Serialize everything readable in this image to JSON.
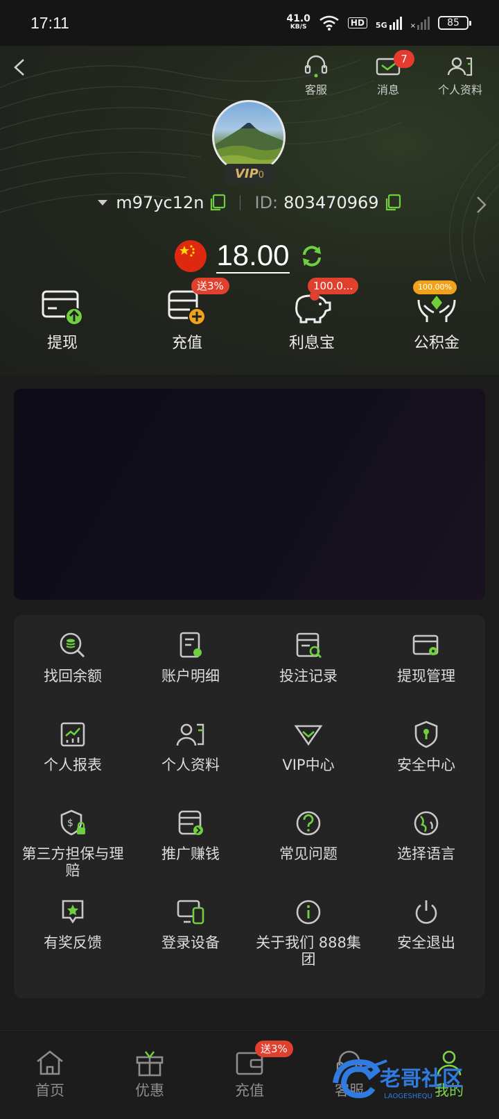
{
  "status_bar": {
    "time": "17:11",
    "net_speed": "41.0",
    "net_unit": "KB/S",
    "hd": "HD",
    "signal": "5G",
    "battery": "85"
  },
  "header": {
    "top_icons": [
      {
        "label": "客服",
        "icon": "headset-icon"
      },
      {
        "label": "消息",
        "icon": "mail-icon",
        "badge": "7"
      },
      {
        "label": "个人资料",
        "icon": "profile-card-icon"
      }
    ],
    "vip_text": "VIP",
    "vip_level": "0",
    "username": "m97yc12n",
    "id_label": "ID:",
    "id_value": "803470969",
    "balance": "18.00"
  },
  "actions": [
    {
      "label": "提现",
      "icon": "withdraw-card-icon",
      "badge": ""
    },
    {
      "label": "充值",
      "icon": "deposit-icon",
      "badge": "送3%"
    },
    {
      "label": "利息宝",
      "icon": "piggy-bank-icon",
      "badge": "100.0..."
    },
    {
      "label": "公积金",
      "icon": "fund-hands-icon",
      "badge": "100.00%"
    }
  ],
  "menu": [
    {
      "label": "找回余额",
      "icon": "recover-balance-icon"
    },
    {
      "label": "账户明细",
      "icon": "account-detail-icon"
    },
    {
      "label": "投注记录",
      "icon": "bet-record-icon"
    },
    {
      "label": "提现管理",
      "icon": "withdraw-manage-icon"
    },
    {
      "label": "个人报表",
      "icon": "report-chart-icon"
    },
    {
      "label": "个人资料",
      "icon": "profile-icon"
    },
    {
      "label": "VIP中心",
      "icon": "vip-diamond-icon"
    },
    {
      "label": "安全中心",
      "icon": "shield-icon"
    },
    {
      "label": "第三方担保与理赔",
      "icon": "guarantee-shield-icon"
    },
    {
      "label": "推广赚钱",
      "icon": "promote-icon"
    },
    {
      "label": "常见问题",
      "icon": "question-icon"
    },
    {
      "label": "选择语言",
      "icon": "globe-icon"
    },
    {
      "label": "有奖反馈",
      "icon": "feedback-star-icon"
    },
    {
      "label": "登录设备",
      "icon": "devices-icon"
    },
    {
      "label": "关于我们 888集团",
      "icon": "info-icon"
    },
    {
      "label": "安全退出",
      "icon": "power-icon"
    }
  ],
  "tabs": [
    {
      "label": "首页",
      "icon": "home-icon"
    },
    {
      "label": "优惠",
      "icon": "gift-icon"
    },
    {
      "label": "充值",
      "icon": "wallet-icon",
      "badge": "送3%"
    },
    {
      "label": "客服",
      "icon": "headset-icon"
    },
    {
      "label": "我的",
      "icon": "user-icon",
      "active": true
    }
  ],
  "watermark": {
    "text": "老哥社区",
    "sub": "LAOGESHEQU"
  },
  "colors": {
    "accent_green": "#6fcf3f",
    "badge_red": "#e0402e",
    "badge_gold": "#f1a21b",
    "bg": "#1b1c1b"
  }
}
